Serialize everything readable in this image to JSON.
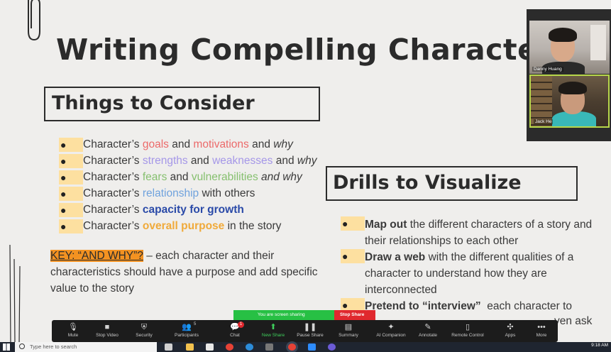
{
  "slide": {
    "title": "Writing Compelling Characte",
    "consider_heading": "Things to Consider",
    "drills_heading": "Drills to Visualize",
    "bullet_glyph": "●",
    "bullets": [
      [
        {
          "text": "Character’s ",
          "cls": "t"
        },
        {
          "text": "goals",
          "cls": "red"
        },
        {
          "text": " and ",
          "cls": "t"
        },
        {
          "text": "motivations",
          "cls": "red"
        },
        {
          "text": " and ",
          "cls": "t"
        },
        {
          "text": "why",
          "cls": "t ital"
        }
      ],
      [
        {
          "text": "Character’s ",
          "cls": "t"
        },
        {
          "text": "strengths",
          "cls": "purple"
        },
        {
          "text": " and ",
          "cls": "t"
        },
        {
          "text": "weaknesses",
          "cls": "purple"
        },
        {
          "text": " and ",
          "cls": "t"
        },
        {
          "text": "why",
          "cls": "t ital"
        }
      ],
      [
        {
          "text": "Character’s ",
          "cls": "t"
        },
        {
          "text": "fears",
          "cls": "green"
        },
        {
          "text": " and ",
          "cls": "t"
        },
        {
          "text": "vulnerabilities",
          "cls": "green"
        },
        {
          "text": " and why",
          "cls": "t ital"
        }
      ],
      [
        {
          "text": "Character’s ",
          "cls": "t"
        },
        {
          "text": "relationship",
          "cls": "lblue"
        },
        {
          "text": " with others",
          "cls": "t"
        }
      ],
      [
        {
          "text": "Character’s ",
          "cls": "t"
        },
        {
          "text": "capacity for growth",
          "cls": "dblue"
        }
      ],
      [
        {
          "text": "Character’s ",
          "cls": "t"
        },
        {
          "text": "overall purpose",
          "cls": "orange"
        },
        {
          "text": " in the story",
          "cls": "t"
        }
      ]
    ],
    "key_label": "KEY: “AND WHY”?",
    "key_text": " – each character and their characteristics should have a purpose and add specific value to the story",
    "drills": [
      {
        "bold": "Map out",
        "rest": " the different characters of a story and their relationships to each other"
      },
      {
        "bold": "Draw a web",
        "rest": " with the different qualities of a character to understand how they are interconnected"
      },
      {
        "bold": "Pretend to “interview”",
        "rest": "  each character to"
      }
    ],
    "drills_partial": "yen ask"
  },
  "video": {
    "participants": [
      {
        "name": "Danny Huang"
      },
      {
        "name": "Jack He"
      }
    ]
  },
  "sharing": {
    "status": "You are screen sharing",
    "stop": "Stop Share"
  },
  "toolbar": {
    "buttons": [
      {
        "label": "Mute",
        "icon": "microphone-icon",
        "glyph": "🎙"
      },
      {
        "label": "Stop Video",
        "icon": "video-camera-icon",
        "glyph": "■"
      },
      {
        "label": "Security",
        "icon": "shield-icon",
        "glyph": "⛨"
      },
      {
        "label": "Participants",
        "icon": "participants-icon",
        "glyph": "👥",
        "count": "5"
      },
      {
        "label": "Chat",
        "icon": "chat-icon",
        "glyph": "💬",
        "badge": "1"
      },
      {
        "label": "New Share",
        "icon": "share-screen-icon",
        "glyph": "⬆",
        "accent": true
      },
      {
        "label": "Pause Share",
        "icon": "pause-icon",
        "glyph": "❚❚"
      },
      {
        "label": "Summary",
        "icon": "summary-icon",
        "glyph": "▤"
      },
      {
        "label": "AI Companion",
        "icon": "sparkle-icon",
        "glyph": "✦"
      },
      {
        "label": "Annotate",
        "icon": "pencil-icon",
        "glyph": "✎"
      },
      {
        "label": "Remote Control",
        "icon": "remote-control-icon",
        "glyph": "▯"
      },
      {
        "label": "Apps",
        "icon": "apps-icon",
        "glyph": "✣"
      },
      {
        "label": "More",
        "icon": "more-icon",
        "glyph": "•••"
      }
    ]
  },
  "taskbar": {
    "search_placeholder": "Type here to search",
    "time": "9:18 AM"
  },
  "colors": {
    "accent_green": "#27c044",
    "stop_red": "#e0282e",
    "key_orange": "#f39221",
    "bullet_highlight": "#fde0a0"
  }
}
